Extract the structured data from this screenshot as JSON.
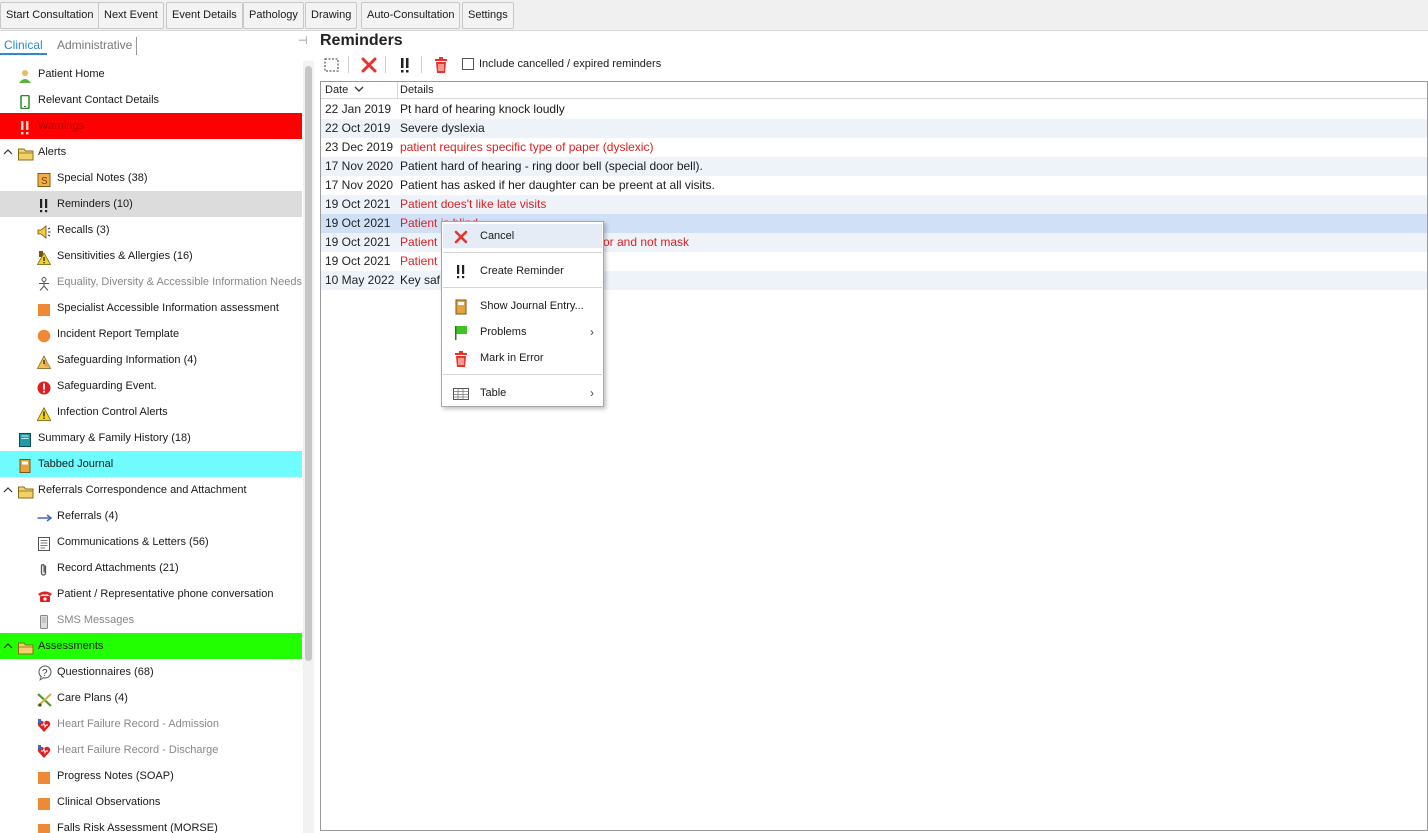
{
  "toolbar": {
    "buttons": [
      "Start Consultation",
      "Next Event",
      "Event Details",
      "Pathology",
      "Drawing",
      "Auto-Consultation",
      "Settings"
    ]
  },
  "left": {
    "tabs": [
      "Clinical",
      "Administrative"
    ],
    "tree": [
      {
        "label": "Patient Home",
        "icon": "patient-icon"
      },
      {
        "label": "Relevant Contact Details",
        "icon": "phone-icon"
      },
      {
        "label": "Warnings",
        "icon": "warning-exclamation-icon",
        "highlight": "#ff0000"
      },
      {
        "label": "Alerts",
        "icon": "folder-icon",
        "expanded": true
      },
      {
        "label": "Special Notes (38)",
        "icon": "notes-icon"
      },
      {
        "label": "Reminders (10)",
        "icon": "reminder-icon",
        "selected": true
      },
      {
        "label": "Recalls (3)",
        "icon": "megaphone-icon"
      },
      {
        "label": "Sensitivities & Allergies (16)",
        "icon": "allergy-warning-icon"
      },
      {
        "label": "Equality, Diversity & Accessible Information Needs",
        "icon": "person-icon",
        "muted": true
      },
      {
        "label": "Specialist Accessible Information assessment",
        "icon": "form-icon"
      },
      {
        "label": "Incident Report Template",
        "icon": "circle-form-icon"
      },
      {
        "label": "Safeguarding Information (4)",
        "icon": "safeguarding-icon"
      },
      {
        "label": "Safeguarding Event.",
        "icon": "alert-circle-icon"
      },
      {
        "label": "Infection Control Alerts",
        "icon": "warning-triangle-icon"
      },
      {
        "label": "Summary & Family History (18)",
        "icon": "book-icon"
      },
      {
        "label": "Tabbed Journal",
        "icon": "journal-icon",
        "highlight": "#6ffcff"
      },
      {
        "label": "Referrals Correspondence and Attachment",
        "icon": "folder-icon",
        "expanded": true
      },
      {
        "label": "Referrals (4)",
        "icon": "arrow-right-icon"
      },
      {
        "label": "Communications & Letters (56)",
        "icon": "letter-icon"
      },
      {
        "label": "Record Attachments (21)",
        "icon": "paperclip-icon"
      },
      {
        "label": "Patient / Representative phone conversation",
        "icon": "telephone-icon"
      },
      {
        "label": "SMS Messages",
        "icon": "mobile-icon",
        "muted": true
      },
      {
        "label": "Assessments",
        "icon": "folder-icon",
        "expanded": true,
        "highlight": "#22ff00"
      },
      {
        "label": "Questionnaires (68)",
        "icon": "question-icon"
      },
      {
        "label": "Care Plans (4)",
        "icon": "care-plan-icon"
      },
      {
        "label": "Heart Failure Record - Admission",
        "icon": "heart-icon",
        "muted": true
      },
      {
        "label": "Heart Failure Record - Discharge",
        "icon": "heart-icon",
        "muted": true
      },
      {
        "label": "Progress Notes (SOAP)",
        "icon": "form-icon"
      },
      {
        "label": "Clinical Observations",
        "icon": "form-icon"
      },
      {
        "label": "Falls Risk Assessment (MORSE)",
        "icon": "form-icon"
      }
    ]
  },
  "reminders": {
    "title": "Reminders",
    "include_label": "Include cancelled / expired reminders",
    "include_checked": false,
    "columns": [
      "Date",
      "Details"
    ],
    "rows": [
      {
        "date": "22 Jan 2019",
        "details": "Pt hard of hearing knock loudly",
        "red": false
      },
      {
        "date": "22 Oct 2019",
        "details": "Severe dyslexia",
        "red": false
      },
      {
        "date": "23 Dec 2019",
        "details": "patient requires specific type of paper (dyslexic)",
        "red": true
      },
      {
        "date": "17 Nov 2020",
        "details": "Patient hard of hearing - ring door bell (special door bell).",
        "red": false
      },
      {
        "date": "17 Nov 2020",
        "details": "Patient has asked if her daughter can be preent at all visits.",
        "red": false
      },
      {
        "date": "19 Oct 2021",
        "details": "Patient does't like late visits",
        "red": true
      },
      {
        "date": "19 Oct 2021",
        "details": "Patient is blind",
        "red": true,
        "selected": true
      },
      {
        "date": "19 Oct 2021",
        "details": "Patient ",
        "details_tail": "or and not mask",
        "red": true
      },
      {
        "date": "19 Oct 2021",
        "details": "Patient ",
        "red": true
      },
      {
        "date": "10 May 2022",
        "details": "Key saf",
        "red": false
      }
    ]
  },
  "context_menu": {
    "items": [
      {
        "label": "Cancel",
        "icon": "cancel-x-icon"
      },
      {
        "label": "Create Reminder",
        "icon": "reminder-icon"
      },
      {
        "label": "Show Journal Entry...",
        "icon": "journal-icon"
      },
      {
        "label": "Problems",
        "icon": "flag-icon",
        "submenu": true
      },
      {
        "label": "Mark in Error",
        "icon": "trash-icon"
      },
      {
        "label": "Table",
        "icon": "table-icon",
        "submenu": true
      }
    ]
  },
  "colors": {
    "accent": "#2a8bd0",
    "warnings_bg": "#ff0000",
    "journal_bg": "#6ffcff",
    "assessments_bg": "#22ff00",
    "red_text": "#e02020"
  }
}
